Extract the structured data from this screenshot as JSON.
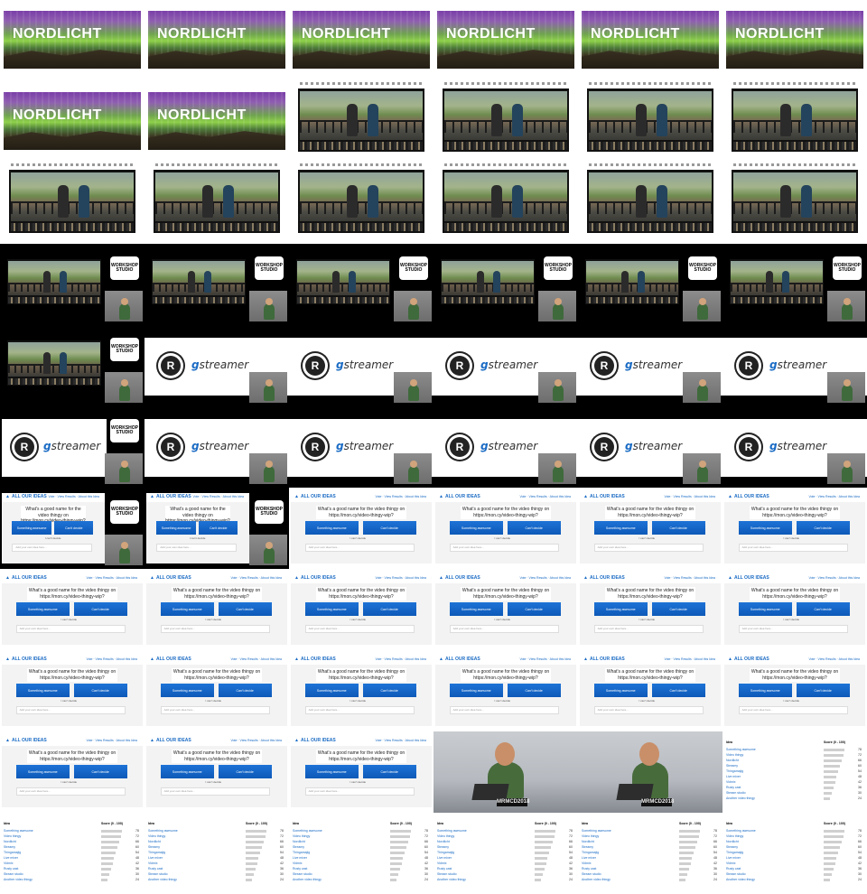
{
  "aurora_title": "NORDLICHT",
  "slide": {
    "rust_glyph": "R",
    "gstreamer_g": "g",
    "gstreamer_rest": "streamer"
  },
  "conf_logo_text": "WORKSHOP STUDIO",
  "app": {
    "brand": "ALL OUR IDEAS",
    "nav": "Vote  ·  View Results  ·  About this Idea",
    "question": "What's a good name for the video thingy on https://mon.cy/video-thingy-wip?",
    "option_a": "Something awesome",
    "option_b": "Can't decide",
    "note": "I can't decide",
    "input_placeholder": "Add your own idea here..."
  },
  "table": {
    "col_idea": "Idea",
    "col_score": "Score (0 - 100)",
    "rows": [
      {
        "name": "Something awesome",
        "score": 78
      },
      {
        "name": "Video thingy",
        "score": 72
      },
      {
        "name": "Nordlicht",
        "score": 66
      },
      {
        "name": "Streamy",
        "score": 60
      },
      {
        "name": "Thingamajig",
        "score": 54
      },
      {
        "name": "Live mixer",
        "score": 48
      },
      {
        "name": "Vidmix",
        "score": 42
      },
      {
        "name": "Rusty cast",
        "score": 36
      },
      {
        "name": "Stream studio",
        "score": 30
      },
      {
        "name": "Another video thingy",
        "score": 24
      }
    ]
  },
  "photo_sticker": "MRMCD2018",
  "tile_sequence": [
    "aurora",
    "aurora",
    "aurora",
    "aurora",
    "aurora",
    "aurora",
    "aurora",
    "aurora",
    "street",
    "street",
    "street",
    "street",
    "street",
    "street",
    "street",
    "street",
    "street",
    "street",
    "conf",
    "conf",
    "conf",
    "conf",
    "conf",
    "conf",
    "conf",
    "slide",
    "slide",
    "slide",
    "slide",
    "slide",
    "slide",
    "slide",
    "slide",
    "slide",
    "slide",
    "slide",
    "appconf",
    "appconf",
    "app",
    "app",
    "app",
    "app",
    "app",
    "app",
    "app",
    "app",
    "app",
    "app",
    "app",
    "app",
    "app",
    "app",
    "app",
    "app",
    "app",
    "app",
    "app",
    "photo",
    "photo",
    "table",
    "table",
    "table",
    "table",
    "table",
    "table",
    "table"
  ]
}
